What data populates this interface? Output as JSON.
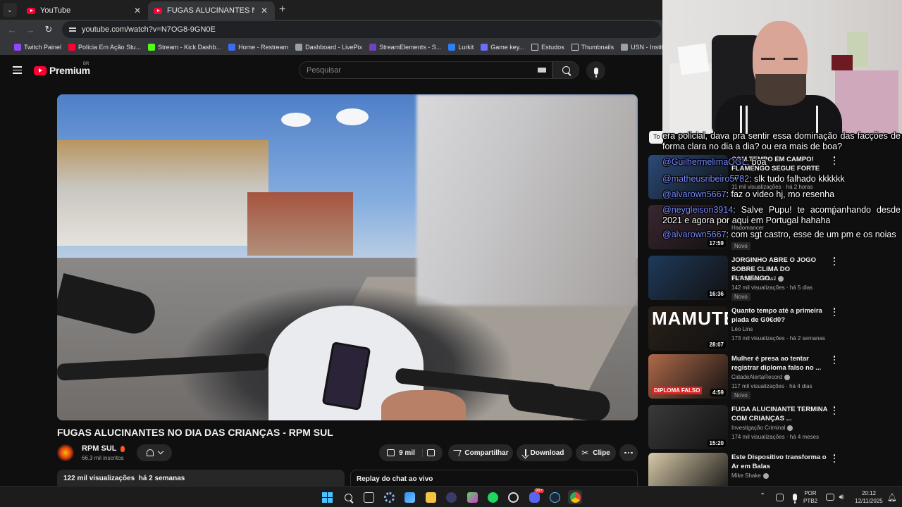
{
  "browser": {
    "tabs": [
      {
        "title": "YouTube",
        "active": false
      },
      {
        "title": "FUGAS ALUCINANTES NO DIA DAS CRIANÇAS - RPM SUL",
        "active": true
      }
    ],
    "url": "youtube.com/watch?v=N7OG8-9GN0E",
    "bookmarks": [
      {
        "label": "Twitch Painel",
        "icon_color": "#9146ff"
      },
      {
        "label": "Polícia Em Ação Stu...",
        "icon_color": "#ff0033"
      },
      {
        "label": "Stream - Kick Dashb...",
        "icon_color": "#53fc18"
      },
      {
        "label": "Home - Restream",
        "icon_color": "#3b6cf6"
      },
      {
        "label": "Dashboard - LivePix",
        "icon_color": "#9aa0a6"
      },
      {
        "label": "StreamElements - S...",
        "icon_color": "#6f42c1"
      },
      {
        "label": "Lurkit",
        "icon_color": "#2d7ff9"
      },
      {
        "label": "Game key...",
        "icon_color": "#6c6cff"
      },
      {
        "label": "Estudos",
        "icon_color": "folder"
      },
      {
        "label": "Thumbnails",
        "icon_color": "folder"
      },
      {
        "label": "USN - Instituto Jone...",
        "icon_color": "#9aa0a6"
      }
    ]
  },
  "yt_header": {
    "logo_text": "Premium",
    "country": "BR",
    "search_placeholder": "Pesquisar"
  },
  "video": {
    "title": "FUGAS ALUCINANTES NO DIA DAS CRIANÇAS - RPM SUL",
    "channel": "RPM SUL",
    "subscribers": "66,3 mil inscritos",
    "likes": "9 mil",
    "share_label": "Compartilhar",
    "download_label": "Download",
    "clip_label": "Clipe",
    "views_date": "122 mil visualizações  há 2 semanas",
    "chat_replay_label": "Replay do chat ao vivo"
  },
  "recommendations": [
    {
      "title": "COM TEMPO EM CAMPO! FLAMENGO SEGUE FORTE NA...",
      "channel": "",
      "meta": "11 mil visualizações · há 2 horas",
      "duration": "",
      "new": "",
      "thumb_color": "#2b4b7a"
    },
    {
      "title": "",
      "channel": "Hadomancer",
      "meta": "",
      "duration": "17:59",
      "new": "Novo",
      "thumb_color": "#3a2630"
    },
    {
      "title": "JORGINHO ABRE O JOGO SOBRE CLIMA DO FLAMENGO...",
      "channel": "TNT Sports Brasil",
      "meta": "142 mil visualizações · há 5 dias",
      "duration": "16:36",
      "new": "Novo",
      "thumb_color": "#1e3a5a",
      "verified": true
    },
    {
      "title": "Quanto tempo até a primeira piada de G0€d0?",
      "channel": "Léo Lins",
      "meta": "173 mil visualizações · há 2 semanas",
      "duration": "28:07",
      "new": "",
      "thumb_color": "#2a2018",
      "overlay": "MAMUTE"
    },
    {
      "title": "Mulher é presa ao tentar registrar diploma falso no ...",
      "channel": "CidadeAlertaRecord",
      "meta": "117 mil visualizações · há 4 dias",
      "duration": "4:59",
      "new": "Novo",
      "thumb_color": "#b06a4a",
      "verified": true,
      "overlay": "DIPLOMA FALSO"
    },
    {
      "title": "FUGA ALUCINANTE TERMINA COM CRIANÇAS ...",
      "channel": "Investigação Criminal",
      "meta": "174 mil visualizações · há 4 meses",
      "duration": "15:20",
      "new": "",
      "thumb_color": "#3a3a3a",
      "verified": true
    },
    {
      "title": "Este Dispositivo transforma o Ar em Balas",
      "channel": "Mike Shake",
      "meta": "",
      "duration": "",
      "new": "",
      "thumb_color": "#d8c9a8",
      "verified": true
    }
  ],
  "chat": [
    {
      "user": "",
      "text": "era policial, dava pra sentir essa dominação das facções de forma clara no dia a dia? ou era mais de boa?"
    },
    {
      "user": "@GuilhermelimaOGL",
      "text": ": boa"
    },
    {
      "user": "@matheusribeiro5782",
      "text": ": slk tudo falhado kkkkkk"
    },
    {
      "user": "@alvarown5667",
      "text": ": faz o video hj, mo resenha"
    },
    {
      "user": "@neygleison3914",
      "text": ": Salve Pupu! te acompanhando desde 2021 e agora por aqui em Portugal hahaha"
    },
    {
      "user": "@alvarown5667",
      "text": ": com sgt castro, esse de um pm e os noias"
    }
  ],
  "chat_hint": "To",
  "taskbar": {
    "language": "POR",
    "layout": "PTB2",
    "time": "20:12",
    "date": "12/11/2025",
    "discord_badge": "99+"
  }
}
